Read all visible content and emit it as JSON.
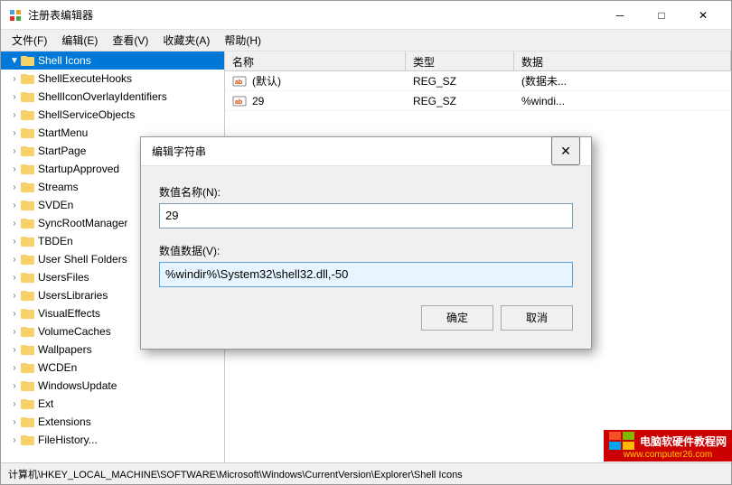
{
  "window": {
    "title": "注册表编辑器",
    "icon": "regedit-icon"
  },
  "titlebar": {
    "min_label": "─",
    "max_label": "□",
    "close_label": "✕"
  },
  "menu": {
    "items": [
      {
        "label": "文件(F)"
      },
      {
        "label": "编辑(E)"
      },
      {
        "label": "查看(V)"
      },
      {
        "label": "收藏夹(A)"
      },
      {
        "label": "帮助(H)"
      }
    ]
  },
  "tree": {
    "items": [
      {
        "label": "Shell Icons",
        "indent": 0,
        "expand": "▲",
        "selected": true
      },
      {
        "label": "ShellExecuteHooks",
        "indent": 0,
        "expand": ">"
      },
      {
        "label": "ShellIconOverlayIdentifiers",
        "indent": 0,
        "expand": ">"
      },
      {
        "label": "ShellServiceObjects",
        "indent": 0,
        "expand": ">"
      },
      {
        "label": "StartMenu",
        "indent": 0,
        "expand": ">"
      },
      {
        "label": "StartPage",
        "indent": 0,
        "expand": ">"
      },
      {
        "label": "StartupApproved",
        "indent": 0,
        "expand": ">"
      },
      {
        "label": "Streams",
        "indent": 0,
        "expand": ">"
      },
      {
        "label": "SVDEn",
        "indent": 0,
        "expand": ">"
      },
      {
        "label": "SyncRootManager",
        "indent": 0,
        "expand": ">"
      },
      {
        "label": "TBDEn",
        "indent": 0,
        "expand": ">"
      },
      {
        "label": "User Shell Folders",
        "indent": 0,
        "expand": ">"
      },
      {
        "label": "UsersFiles",
        "indent": 0,
        "expand": ">"
      },
      {
        "label": "UsersLibraries",
        "indent": 0,
        "expand": ">"
      },
      {
        "label": "VisualEffects",
        "indent": 0,
        "expand": ">"
      },
      {
        "label": "VolumeCaches",
        "indent": 0,
        "expand": ">"
      },
      {
        "label": "Wallpapers",
        "indent": 0,
        "expand": ">"
      },
      {
        "label": "WCDEn",
        "indent": 0,
        "expand": ">"
      },
      {
        "label": "WindowsUpdate",
        "indent": 0,
        "expand": ">"
      },
      {
        "label": "Ext",
        "indent": 0,
        "expand": ">"
      },
      {
        "label": "Extensions",
        "indent": 0,
        "expand": ">"
      },
      {
        "label": "FileHistory...",
        "indent": 0,
        "expand": ">"
      }
    ]
  },
  "table": {
    "headers": [
      {
        "label": "名称",
        "key": "name"
      },
      {
        "label": "类型",
        "key": "type"
      },
      {
        "label": "数据",
        "key": "data"
      }
    ],
    "rows": [
      {
        "name": "(默认)",
        "type": "REG_SZ",
        "data": "(数据未..."
      },
      {
        "name": "29",
        "type": "REG_SZ",
        "data": "%windi..."
      }
    ]
  },
  "statusbar": {
    "text": "计算机\\HKEY_LOCAL_MACHINE\\SOFTWARE\\Microsoft\\Windows\\CurrentVersion\\Explorer\\Shell Icons"
  },
  "watermark": {
    "line1": "电脑软硬件教程网",
    "line2": "www.computer26.com"
  },
  "dialog": {
    "title": "编辑字符串",
    "close_btn": "✕",
    "name_label": "数值名称(N):",
    "name_value": "29",
    "data_label": "数值数据(V):",
    "data_value": "%windir%\\System32\\shell32.dll,-50",
    "ok_label": "确定",
    "cancel_label": "取消"
  }
}
